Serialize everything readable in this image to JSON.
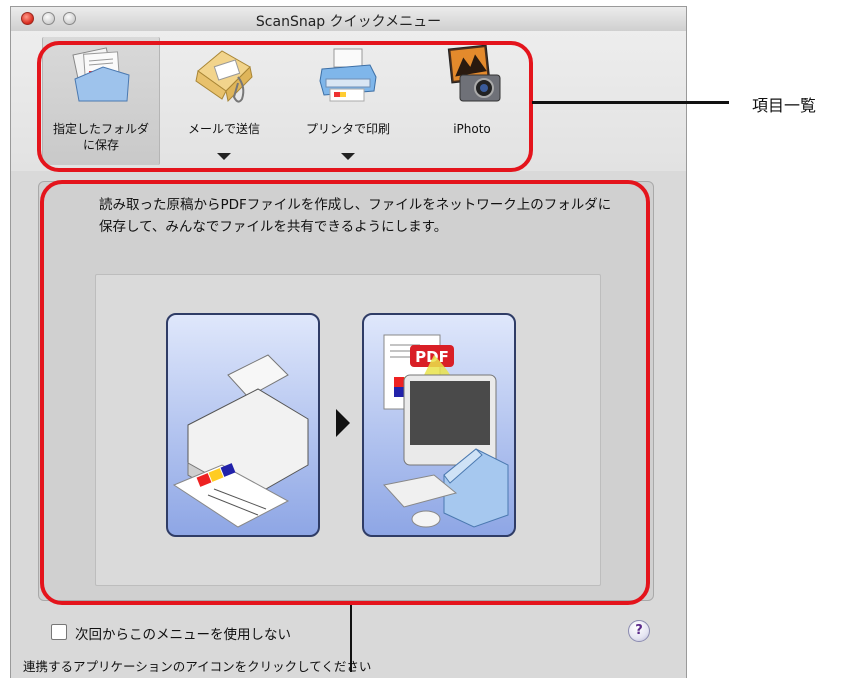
{
  "window": {
    "title": "ScanSnap クイックメニュー"
  },
  "toolbar": {
    "items": [
      {
        "label_line1": "指定したフォルダ",
        "label_line2": "に保存",
        "icon": "folder-save-icon",
        "selected": true,
        "has_dropdown": false
      },
      {
        "label_line1": "メールで送信",
        "label_line2": "",
        "icon": "mail-envelope-icon",
        "selected": false,
        "has_dropdown": true
      },
      {
        "label_line1": "プリンタで印刷",
        "label_line2": "",
        "icon": "printer-icon",
        "selected": false,
        "has_dropdown": true
      },
      {
        "label_line1": "iPhoto",
        "label_line2": "",
        "icon": "iphoto-icon",
        "selected": false,
        "has_dropdown": false
      }
    ]
  },
  "content": {
    "description": "読み取った原稿からPDFファイルを作成し、ファイルをネットワーク上のフォルダに保存して、みんなでファイルを共有できるようにします。",
    "illustration": {
      "left_icon": "scanner-icon",
      "right_icon": "computer-folder-pdf-icon",
      "pdf_badge": "PDF"
    }
  },
  "footer": {
    "checkbox_label": "次回からこのメニューを使用しない",
    "checkbox_checked": false,
    "help_label": "?",
    "status_text": "連携するアプリケーションのアイコンをクリックしてください"
  },
  "annotations": {
    "callout_label": "項目一覧"
  },
  "colors": {
    "highlight": "#e4141c",
    "card_blue": "#aec0ee"
  }
}
